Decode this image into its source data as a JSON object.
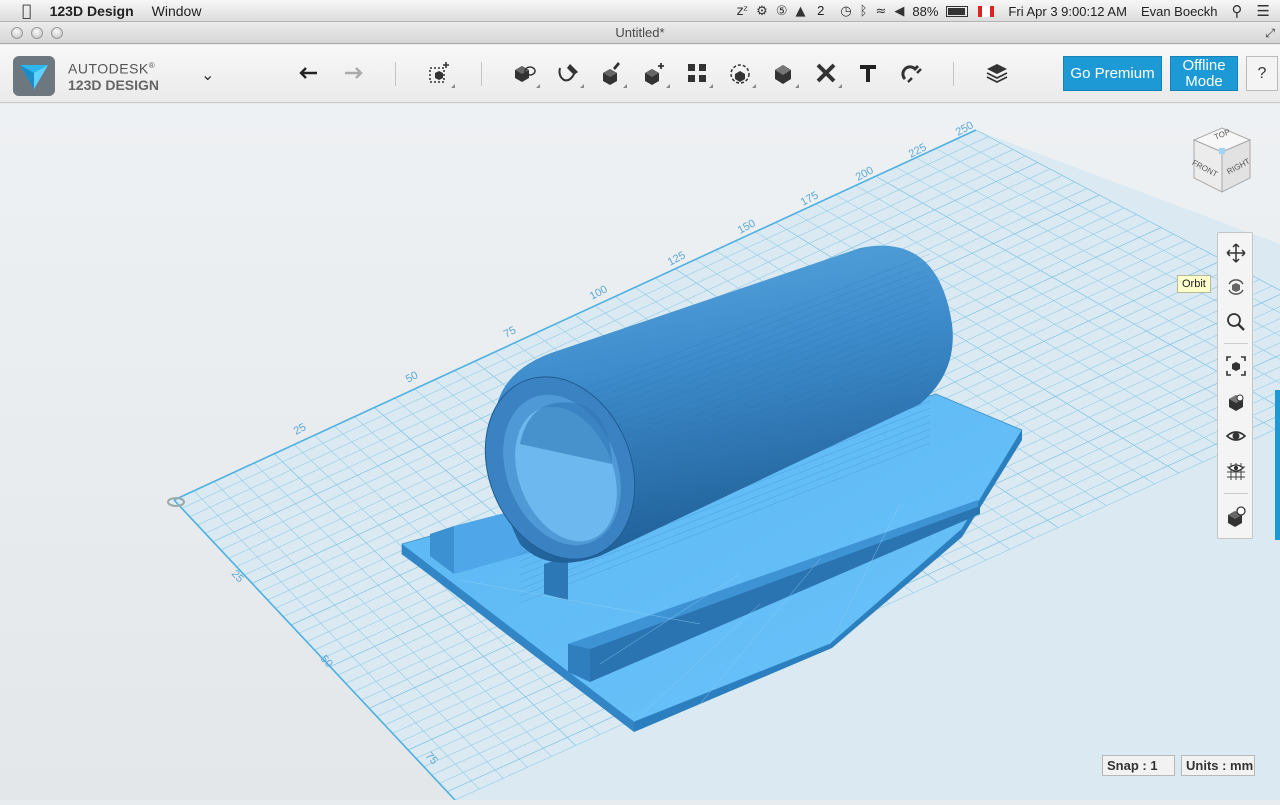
{
  "menubar": {
    "app_name": "123D Design",
    "menu_window": "Window",
    "status_icons": [
      "zzz-icon",
      "sync-icon",
      "five-icon",
      "adobe-icon",
      "time-machine-icon",
      "bluetooth-icon",
      "wifi-icon",
      "volume-icon"
    ],
    "adobe_count": "2",
    "battery": "88%",
    "datetime": "Fri Apr 3  9:00:12 AM",
    "user": "Evan Boeckh"
  },
  "window": {
    "title": "Untitled*"
  },
  "brand": {
    "line1": "AUTODESK",
    "line2": "123D DESIGN",
    "trademark": "®"
  },
  "toolbar": {
    "go_premium": "Go Premium",
    "offline_line1": "Offline",
    "offline_line2": "Mode",
    "help": "?"
  },
  "tooltip": {
    "text": "Orbit"
  },
  "viewcube": {
    "top": "TOP",
    "front": "FRONT",
    "right": "RIGHT"
  },
  "grid_labels": {
    "back_edge": [
      "25",
      "50",
      "75",
      "100",
      "125",
      "150",
      "175",
      "200",
      "225",
      "250"
    ],
    "left_edge": [
      "25",
      "50",
      "75"
    ]
  },
  "model": {
    "color": "#4aa6e8",
    "dark": "#2c7fbf",
    "tube": "#3f8fd0"
  },
  "statusbar": {
    "snap": "Snap : 1",
    "units": "Units : mm"
  },
  "accent": "#1d9ad6"
}
